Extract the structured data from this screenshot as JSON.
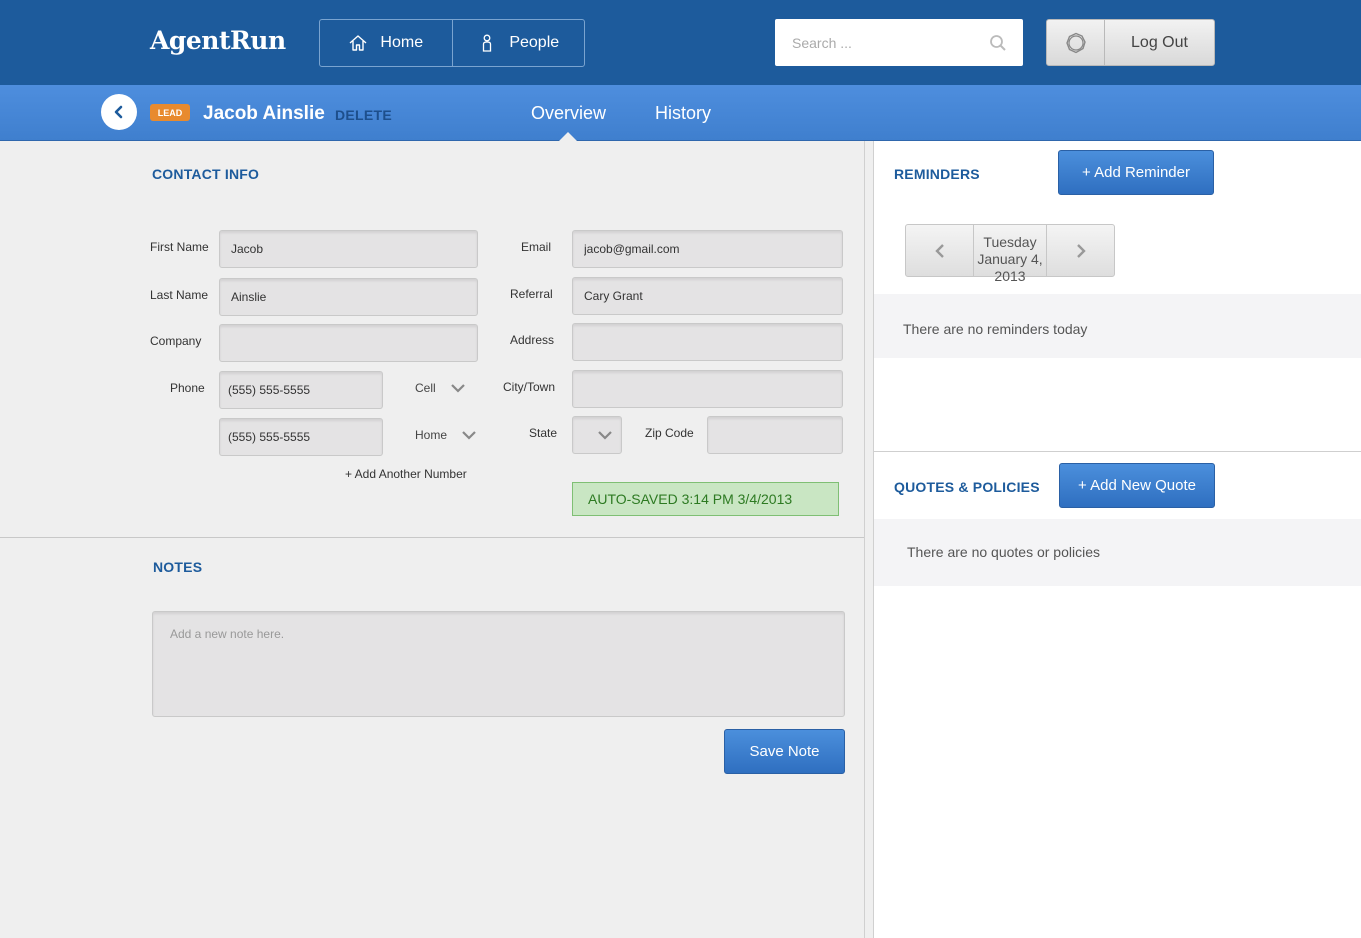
{
  "header": {
    "logo": "AgentRun",
    "nav": [
      {
        "label": "Home",
        "icon": "home-icon"
      },
      {
        "label": "People",
        "icon": "person-icon"
      }
    ],
    "search_placeholder": "Search ...",
    "logout_label": "Log Out"
  },
  "subheader": {
    "badge": "LEAD",
    "name": "Jacob Ainslie",
    "delete_label": "DELETE",
    "tabs": [
      "Overview",
      "History"
    ],
    "active_tab": "Overview"
  },
  "contact": {
    "title": "CONTACT INFO",
    "labels": {
      "first_name": "First Name",
      "last_name": "Last Name",
      "company": "Company",
      "phone": "Phone",
      "email": "Email",
      "referral": "Referral",
      "address": "Address",
      "city": "City/Town",
      "state": "State",
      "zip": "Zip Code"
    },
    "values": {
      "first_name": "Jacob",
      "last_name": "Ainslie",
      "company": "",
      "email": "jacob@gmail.com",
      "referral": "Cary Grant",
      "address": "",
      "city": "",
      "zip": ""
    },
    "phones": [
      {
        "number": "(555) 555-5555",
        "type": "Cell"
      },
      {
        "number": "(555) 555-5555",
        "type": "Home"
      }
    ],
    "add_number": "+ Add Another Number",
    "autosaved": "AUTO-SAVED 3:14 PM 3/4/2013"
  },
  "notes": {
    "title": "NOTES",
    "placeholder": "Add a new note here.",
    "save_label": "Save Note"
  },
  "reminders": {
    "title": "REMINDERS",
    "add_label": "+ Add Reminder",
    "date_day": "Tuesday",
    "date_full": "January 4, 2013",
    "empty": "There are no reminders today"
  },
  "quotes": {
    "title": "QUOTES & POLICIES",
    "add_label": "+ Add New Quote",
    "empty": "There are no quotes or policies"
  },
  "colors": {
    "topbar": "#1d5b9c",
    "subbar": "#4a8ad8",
    "badge": "#e88a2e",
    "button_blue": "#3a7ccc",
    "autosave_bg": "#c9e6c3"
  }
}
